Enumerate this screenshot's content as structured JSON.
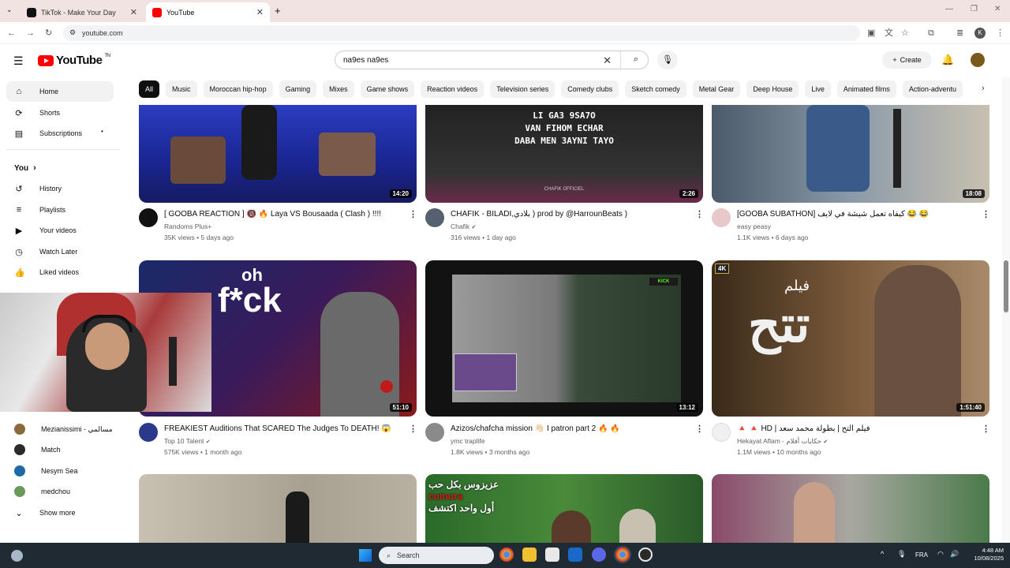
{
  "browser": {
    "tabs": [
      {
        "title": "TikTok - Make Your Day",
        "active": false
      },
      {
        "title": "YouTube",
        "active": true
      }
    ],
    "url": "youtube.com"
  },
  "header": {
    "logo_text": "YouTube",
    "logo_sup": "TN",
    "search_value": "na9es na9es",
    "create_label": "Create"
  },
  "chips": [
    "All",
    "Music",
    "Moroccan hip-hop",
    "Gaming",
    "Mixes",
    "Game shows",
    "Reaction videos",
    "Television series",
    "Comedy clubs",
    "Sketch comedy",
    "Metal Gear",
    "Deep House",
    "Live",
    "Animated films",
    "Action-adventu"
  ],
  "sidebar": {
    "main": [
      {
        "label": "Home",
        "icon": "home-icon"
      },
      {
        "label": "Shorts",
        "icon": "shorts-icon"
      },
      {
        "label": "Subscriptions",
        "icon": "subscriptions-icon"
      }
    ],
    "you_label": "You",
    "you": [
      {
        "label": "History",
        "icon": "history-icon"
      },
      {
        "label": "Playlists",
        "icon": "playlists-icon"
      },
      {
        "label": "Your videos",
        "icon": "your-videos-icon"
      },
      {
        "label": "Watch Later",
        "icon": "watch-later-icon"
      },
      {
        "label": "Liked videos",
        "icon": "liked-videos-icon"
      }
    ],
    "subscriptions": [
      {
        "label": "Mezianissimi - مسالمي",
        "color": "#8a6a3a"
      },
      {
        "label": "Match",
        "color": "#2a2a2a"
      },
      {
        "label": "Nesym Sea",
        "color": "#1e6aa8"
      },
      {
        "label": "medchou",
        "color": "#6a9a5a"
      }
    ],
    "show_more": "Show more"
  },
  "videos": [
    {
      "title": "[ GOOBA REACTION ] 🔞 🔥 Laya VS Bousaada ( Clash ) !!!!",
      "channel": "Randoms Plus+",
      "views": "35K views",
      "age": "5 days ago",
      "duration": "14:20",
      "verified": false,
      "thumb_color": "#2a3aa8"
    },
    {
      "title": "CHAFIK - BILADI,بلادي ) prod by @HarrounBeats )",
      "channel": "Chafik",
      "views": "316 views",
      "age": "1 day ago",
      "duration": "2:26",
      "verified": true,
      "thumb_color": "#2a2a2a"
    },
    {
      "title": "[GOOBA SUBATHON] كيفاه تعمل شيشة في لايف 😂 😂",
      "channel": "easy peasy",
      "views": "1.1K views",
      "age": "6 days ago",
      "duration": "18:08",
      "verified": false,
      "thumb_color": "#5a6a7a"
    },
    {
      "title": "FREAKIEST Auditions That SCARED The Judges To DEATH! 😱",
      "channel": "Top 10 Talent",
      "views": "575K views",
      "age": "1 month ago",
      "duration": "51:10",
      "verified": true,
      "thumb_color": "#3a1a4a"
    },
    {
      "title": "Azizos/chafcha mission 👋🏻 I patron part 2 🔥 🔥",
      "channel": "ymc traplife",
      "views": "1.8K views",
      "age": "3 months ago",
      "duration": "13:12",
      "verified": false,
      "thumb_color": "#1a1a1a"
    },
    {
      "title": "🔺 🔺 HD | فيلم التح | بطولة محمد سعد",
      "channel": "Hekayat Aflam - حكايات أفلام",
      "views": "1.1M views",
      "age": "10 months ago",
      "duration": "1:51:40",
      "verified": true,
      "thumb_color": "#6a4a2a"
    },
    {
      "title": "",
      "channel": "",
      "views": "",
      "age": "",
      "duration": "",
      "verified": false,
      "thumb_color": "#bdb5a8"
    },
    {
      "title": "",
      "channel": "",
      "views": "",
      "age": "",
      "duration": "",
      "verified": false,
      "thumb_color": "#3a7a3a"
    },
    {
      "title": "",
      "channel": "",
      "views": "",
      "age": "",
      "duration": "",
      "verified": false,
      "thumb_color": "#6a8a4a"
    }
  ],
  "thumb_texts": {
    "v2": [
      "LI GA3 9SA7O",
      "VAN FIHOM ECHAR",
      "DABA MEN 3AYNI TAYO"
    ],
    "v2_watermark": "CHAFIK OFFICIEL",
    "v4": "f*ck",
    "v4_sup": "oh",
    "v6_badge": "4K",
    "v6_title": "تتح",
    "v6_sub": "فيلم",
    "v8": [
      "عزيزوس بكل حب",
      "cumura",
      "أول واحد اكتشف"
    ]
  },
  "taskbar": {
    "search_label": "Search",
    "lang": "FRA",
    "time": "4:48 AM",
    "date": "10/08/2025"
  }
}
